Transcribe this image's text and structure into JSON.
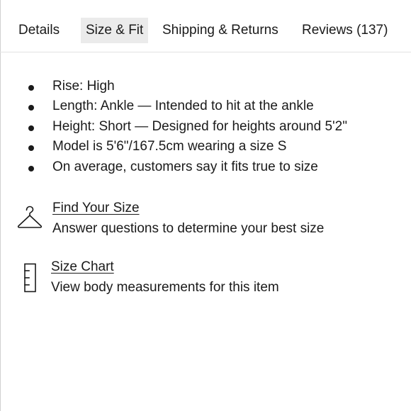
{
  "tabs": [
    {
      "label": "Details",
      "active": false
    },
    {
      "label": "Size & Fit",
      "active": true
    },
    {
      "label": "Shipping & Returns",
      "active": false
    },
    {
      "label": "Reviews (137)",
      "active": false
    }
  ],
  "fit_details": [
    "Rise: High",
    "Length: Ankle — Intended to hit at the ankle",
    "Height: Short — Designed for heights around 5'2\"",
    "Model is 5'6\"/167.5cm wearing a size S",
    "On average, customers say it fits true to size"
  ],
  "find_your_size": {
    "icon": "hanger-icon",
    "title": "Find Your Size",
    "description": "Answer questions to determine your best size"
  },
  "size_chart": {
    "icon": "ruler-icon",
    "title": "Size Chart",
    "description": "View body measurements for this item"
  },
  "colors": {
    "text": "#1a1a1a",
    "active_tab_bg": "#ebebeb",
    "divider": "#e2e2e2"
  }
}
